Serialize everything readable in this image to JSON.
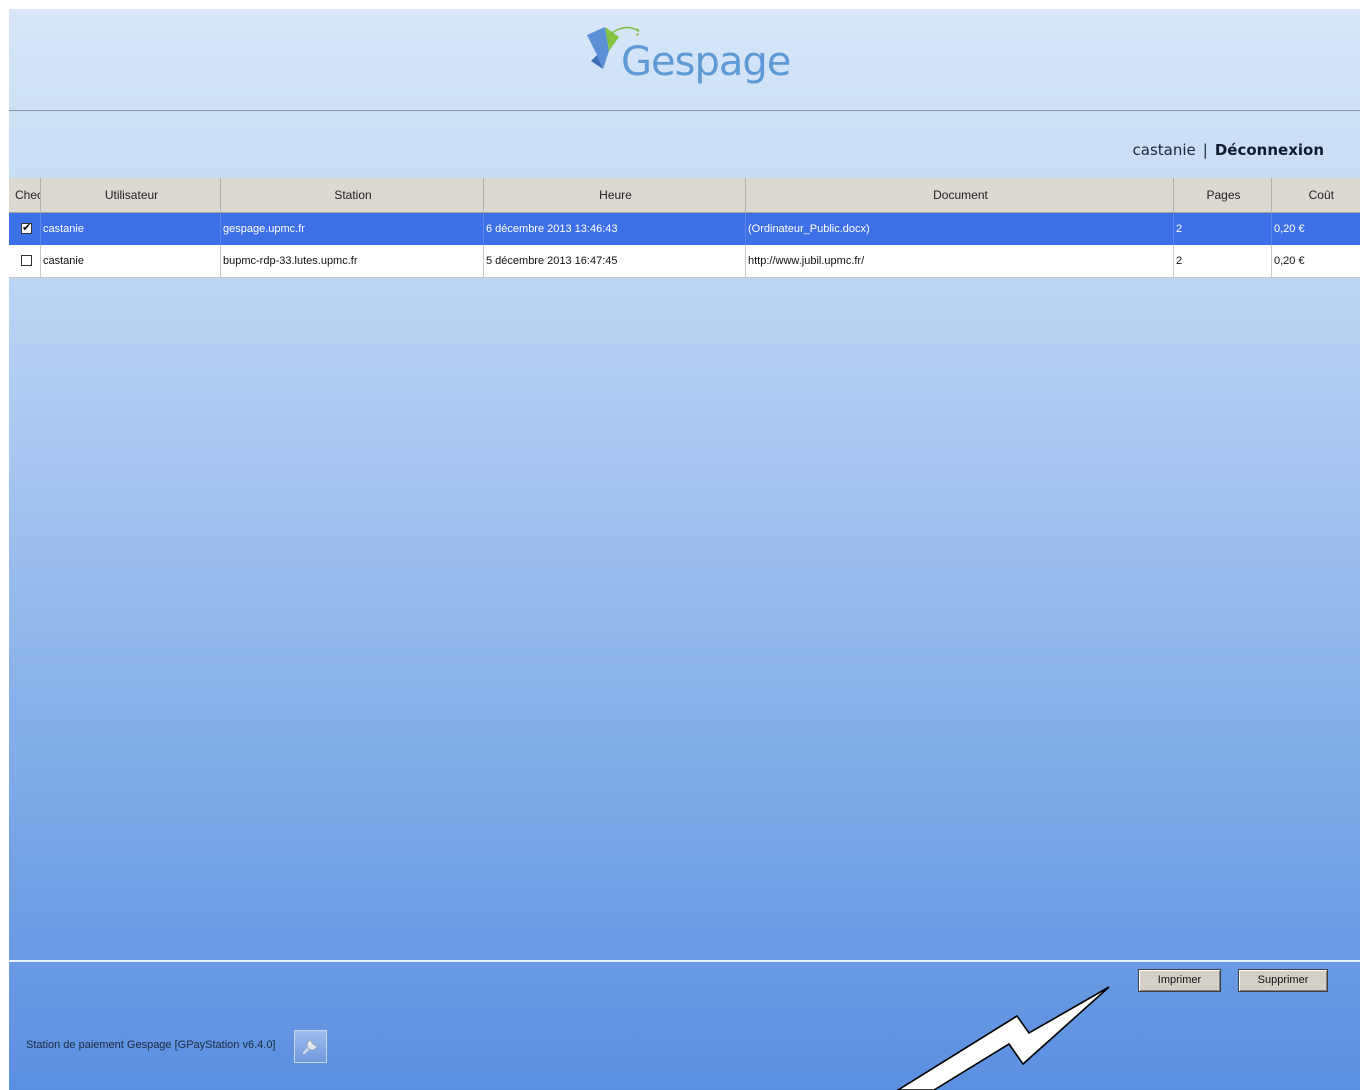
{
  "brand": {
    "name": "Gespage"
  },
  "user": {
    "name": "castanie",
    "separator": "|",
    "logout_label": "Déconnexion"
  },
  "table": {
    "columns": [
      "Chec",
      "Utilisateur",
      "Station",
      "Heure",
      "Document",
      "Pages",
      "Coût"
    ],
    "rows": [
      {
        "checked": true,
        "user": "castanie",
        "station": "gespage.upmc.fr",
        "time": "6 décembre 2013 13:46:43",
        "document": "(Ordinateur_Public.docx)",
        "pages": "2",
        "cost": "0,20 €"
      },
      {
        "checked": false,
        "user": "castanie",
        "station": "bupmc-rdp-33.lutes.upmc.fr",
        "time": "5 décembre 2013 16:47:45",
        "document": "http://www.jubil.upmc.fr/",
        "pages": "2",
        "cost": "0,20 €"
      }
    ]
  },
  "actions": {
    "print_label": "Imprimer",
    "delete_label": "Supprimer"
  },
  "footer": {
    "station_label": "Station de paiement Gespage [GPayStation v6.4.0]",
    "settings_icon": "wrench-icon"
  },
  "colors": {
    "selection": "#3d6fe6",
    "logo": "#5e9bd6",
    "header_bg": "#d8e6f8",
    "footer_bg": "#5b8fe0"
  }
}
